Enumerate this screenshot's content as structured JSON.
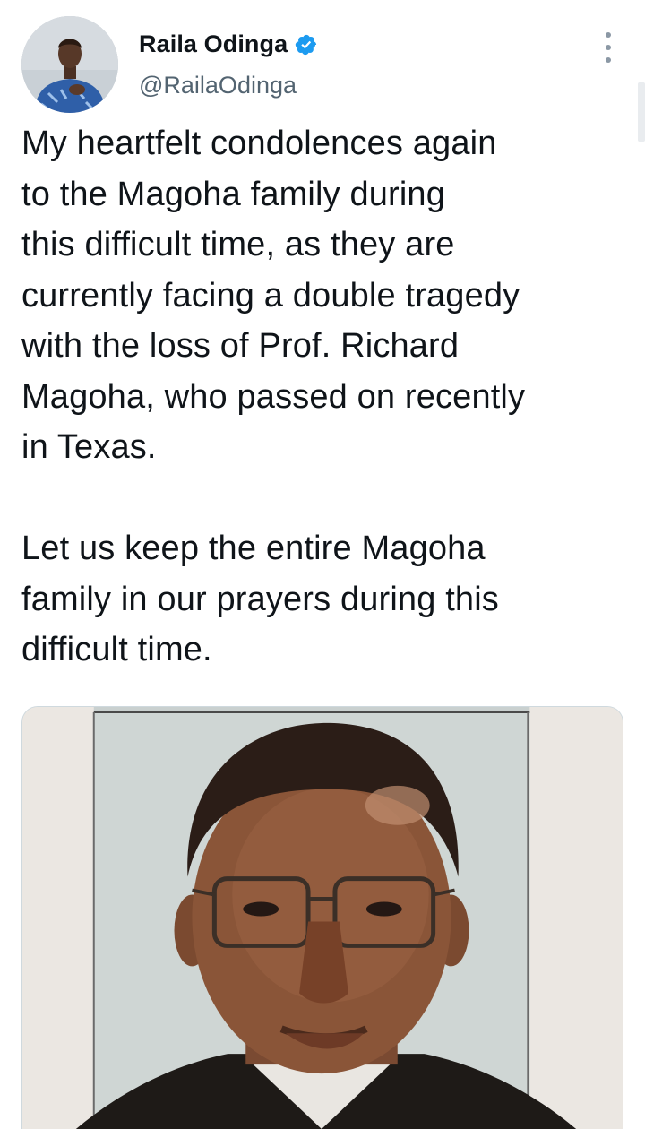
{
  "tweet": {
    "author": {
      "display_name": "Raila Odinga",
      "handle": "@RailaOdinga",
      "verified": true
    },
    "text_paragraphs": [
      "My heartfelt condolences again\nto the Magoha family during\nthis difficult time, as they are\ncurrently facing a double tragedy\nwith the loss of Prof. Richard\nMagoha, who passed on recently\nin Texas.",
      "Let us keep the entire Magoha\nfamily in our prayers during this\ndifficult time."
    ],
    "media": {
      "type": "photo",
      "subject": "portrait-photo"
    }
  },
  "icons": {
    "verified": "verified-badge-icon",
    "more": "more-options-icon"
  },
  "colors": {
    "verified_blue": "#1d9bf0",
    "text_primary": "#0f1419",
    "text_secondary": "#536471"
  }
}
